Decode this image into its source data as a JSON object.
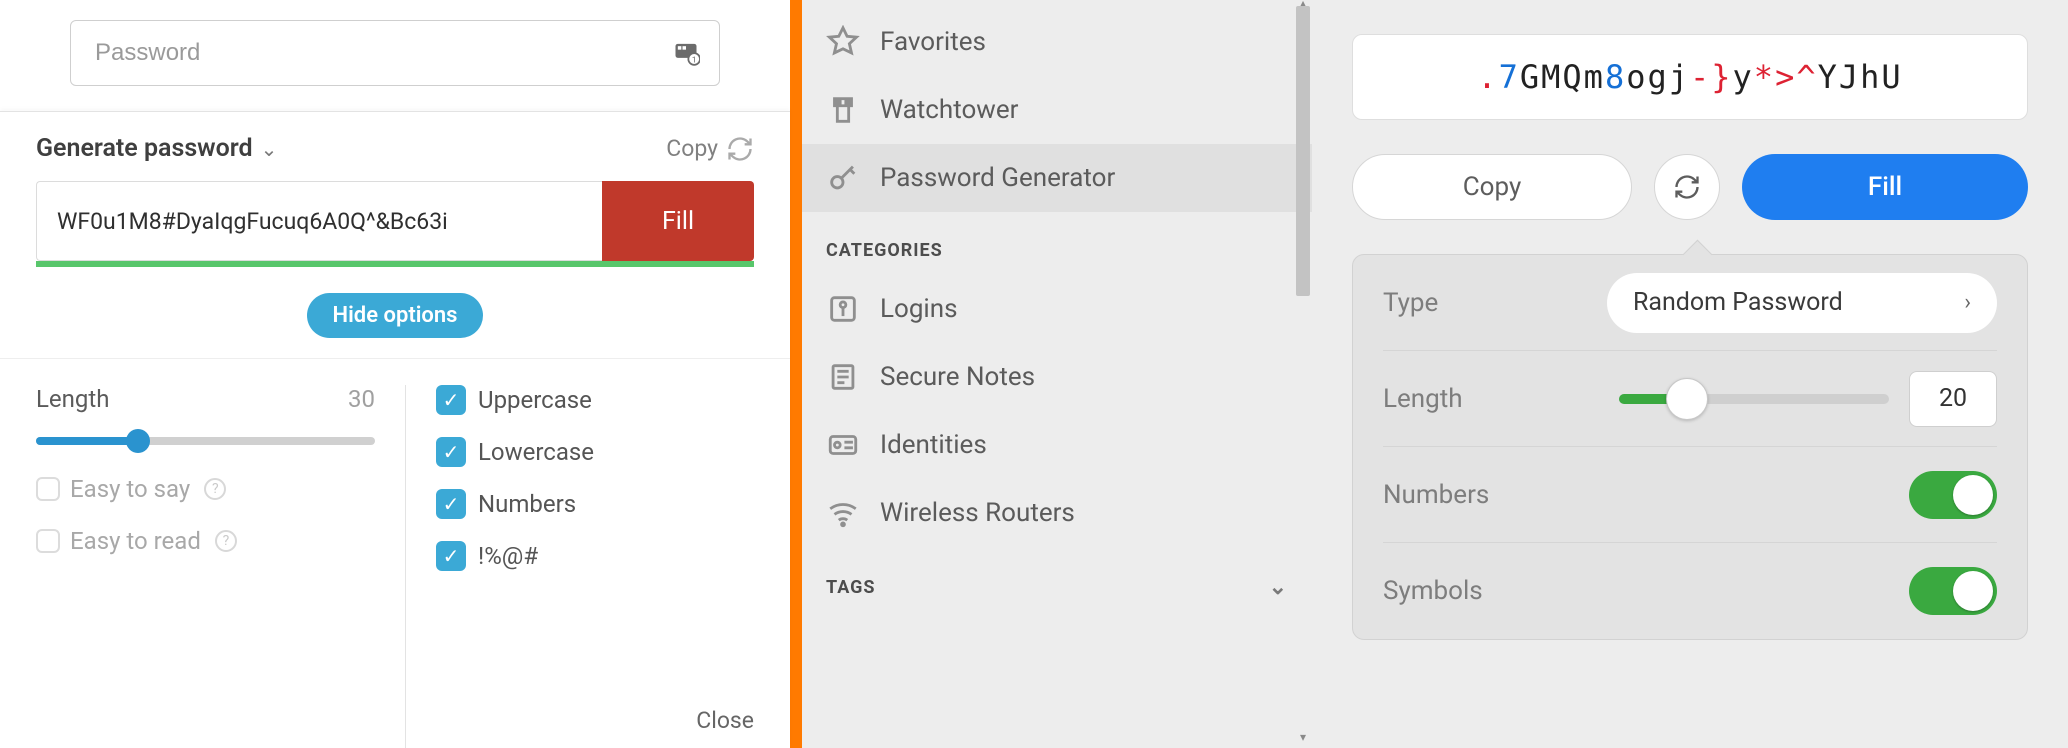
{
  "left": {
    "password_placeholder": "Password",
    "popup_title": "Generate password",
    "copy_label": "Copy",
    "generated_value": "WF0u1M8#DyaIqgFucuq6A0Q^&Bc63i",
    "fill_label": "Fill",
    "hide_options_label": "Hide options",
    "length_label": "Length",
    "length_value": "30",
    "easy_say_label": "Easy to say",
    "easy_read_label": "Easy to read",
    "uppercase_label": "Uppercase",
    "lowercase_label": "Lowercase",
    "numbers_label": "Numbers",
    "symbols_label": "!%@#",
    "close_label": "Close"
  },
  "mid": {
    "items_top": [
      {
        "name": "favorites",
        "label": "Favorites"
      },
      {
        "name": "watchtower",
        "label": "Watchtower"
      },
      {
        "name": "password-generator",
        "label": "Password Generator",
        "active": true
      }
    ],
    "categories_header": "CATEGORIES",
    "items_cat": [
      {
        "name": "logins",
        "label": "Logins"
      },
      {
        "name": "secure-notes",
        "label": "Secure Notes"
      },
      {
        "name": "identities",
        "label": "Identities"
      },
      {
        "name": "wireless-routers",
        "label": "Wireless Routers"
      }
    ],
    "tags_header": "TAGS"
  },
  "right": {
    "password_chars": [
      {
        "c": ".",
        "t": "sym"
      },
      {
        "c": "7",
        "t": "num"
      },
      {
        "c": "G",
        "t": "let"
      },
      {
        "c": "M",
        "t": "let"
      },
      {
        "c": "Q",
        "t": "let"
      },
      {
        "c": "m",
        "t": "let"
      },
      {
        "c": "8",
        "t": "num"
      },
      {
        "c": "o",
        "t": "let"
      },
      {
        "c": "g",
        "t": "let"
      },
      {
        "c": "j",
        "t": "let"
      },
      {
        "c": "-",
        "t": "sym"
      },
      {
        "c": "}",
        "t": "sym"
      },
      {
        "c": "y",
        "t": "let"
      },
      {
        "c": "*",
        "t": "sym"
      },
      {
        "c": ">",
        "t": "sym"
      },
      {
        "c": "^",
        "t": "sym"
      },
      {
        "c": "Y",
        "t": "let"
      },
      {
        "c": "J",
        "t": "let"
      },
      {
        "c": "h",
        "t": "let"
      },
      {
        "c": "U",
        "t": "let"
      }
    ],
    "copy_label": "Copy",
    "fill_label": "Fill",
    "type_label": "Type",
    "type_value": "Random Password",
    "length_label": "Length",
    "length_value": "20",
    "numbers_label": "Numbers",
    "symbols_label": "Symbols"
  }
}
